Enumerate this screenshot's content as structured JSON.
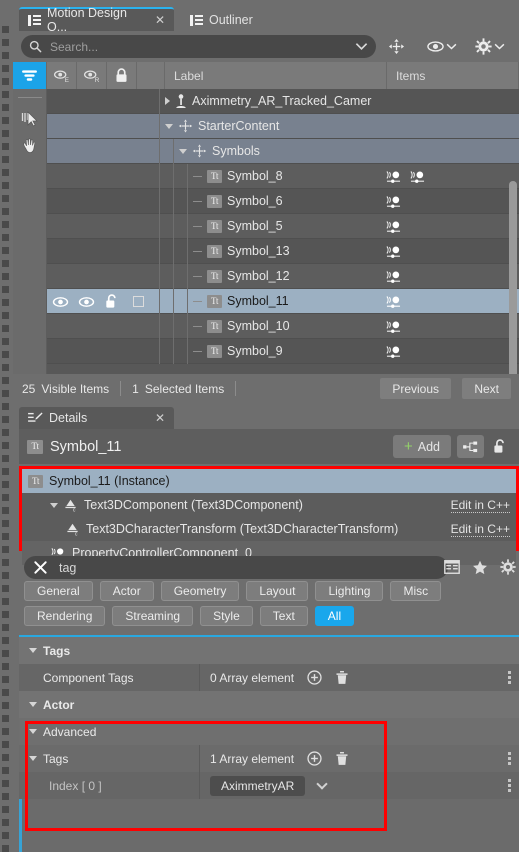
{
  "outliner": {
    "tabs": [
      {
        "label": "Motion Design O...",
        "icon": "list-icon",
        "active": true,
        "close": "✕"
      },
      {
        "label": "Outliner",
        "icon": "list-icon",
        "active": false
      }
    ],
    "search": {
      "placeholder": "Search...",
      "value": ""
    },
    "columns": {
      "label": "Label",
      "items": "Items"
    },
    "column_icons": {
      "filter": "filter-icon",
      "eye_e": "eye-e-icon",
      "eye_r": "eye-r-icon",
      "lock": "lock-icon"
    },
    "header_icons": [
      "move-icon",
      "eye-dropdown-icon",
      "settings-dropdown-icon"
    ],
    "toolbar_icons": [
      "select-cursor-icon",
      "hand-icon"
    ],
    "rows": [
      {
        "name": "Aximmetry_AR_Tracked_Camer",
        "depth": 3,
        "expander": "right",
        "icon": "actor-icon",
        "state": "dark",
        "items": 0
      },
      {
        "name": "StarterContent",
        "depth": 3,
        "expander": "down",
        "icon": "folder-move-icon",
        "state": "hl",
        "items": 0
      },
      {
        "name": "Symbols",
        "depth": 4,
        "expander": "down",
        "icon": "folder-move-icon",
        "state": "hl",
        "items": 0
      },
      {
        "name": "Symbol_8",
        "depth": 5,
        "expander": "none",
        "icon": "text3d-icon",
        "state": "alt",
        "items": 2
      },
      {
        "name": "Symbol_6",
        "depth": 5,
        "expander": "none",
        "icon": "text3d-icon",
        "state": "dark",
        "items": 1
      },
      {
        "name": "Symbol_5",
        "depth": 5,
        "expander": "none",
        "icon": "text3d-icon",
        "state": "alt",
        "items": 1
      },
      {
        "name": "Symbol_13",
        "depth": 5,
        "expander": "none",
        "icon": "text3d-icon",
        "state": "dark",
        "items": 1
      },
      {
        "name": "Symbol_12",
        "depth": 5,
        "expander": "none",
        "icon": "text3d-icon",
        "state": "alt",
        "items": 1
      },
      {
        "name": "Symbol_11",
        "depth": 5,
        "expander": "none",
        "icon": "text3d-icon",
        "state": "sel",
        "items": 1
      },
      {
        "name": "Symbol_10",
        "depth": 5,
        "expander": "none",
        "icon": "text3d-icon",
        "state": "alt",
        "items": 1
      },
      {
        "name": "Symbol_9",
        "depth": 5,
        "expander": "none",
        "icon": "text3d-icon",
        "state": "dark",
        "items": 1
      }
    ],
    "status": {
      "visible_count": "25",
      "visible_label": "Visible Items",
      "selected_count": "1",
      "selected_label": "Selected Items",
      "previous": "Previous",
      "next": "Next"
    }
  },
  "details": {
    "tab": {
      "label": "Details",
      "icon": "details-pencil-icon",
      "close": "✕"
    },
    "header": {
      "title": "Symbol_11",
      "icon": "text3d-icon",
      "add_label": "Add",
      "add_icon": "plus-icon",
      "graph_icon": "blueprint-icon",
      "lock_icon": "unlock-icon"
    },
    "components": [
      {
        "label": "Symbol_11 (Instance)",
        "icon": "text3d-icon",
        "depth": 0,
        "expander": "none",
        "selected": true,
        "action": ""
      },
      {
        "label": "Text3DComponent (Text3DComponent)",
        "icon": "text3d-comp-icon",
        "depth": 1,
        "expander": "down",
        "selected": false,
        "action": "Edit in C++"
      },
      {
        "label": "Text3DCharacterTransform (Text3DCharacterTransform)",
        "icon": "text3d-comp-icon",
        "depth": 2,
        "expander": "none",
        "selected": false,
        "action": "Edit in C++"
      },
      {
        "label": "PropertyControllerComponent_0",
        "icon": "property-controller-icon",
        "depth": 1,
        "expander": "none",
        "selected": false,
        "action": ""
      }
    ],
    "property_search": {
      "value": "tag",
      "clear_icon": "clear-x-icon",
      "icons": [
        "table-view-icon",
        "favorite-star-icon",
        "settings-gear-icon"
      ]
    },
    "filter_chips_row1": [
      "General",
      "Actor",
      "Geometry",
      "Layout",
      "Lighting",
      "Misc"
    ],
    "filter_chips_row2": [
      "Rendering",
      "Streaming",
      "Style",
      "Text",
      "All"
    ],
    "active_chip": "All",
    "properties": [
      {
        "kind": "category",
        "name": "Tags",
        "value": "",
        "expander": "down",
        "highlight": false
      },
      {
        "kind": "row",
        "name": "Component Tags",
        "value": "0 Array element",
        "expander": "none",
        "add_icon": "add-circle-icon",
        "delete_icon": "trash-icon",
        "menu": true,
        "highlight": false
      },
      {
        "kind": "category",
        "name": "Actor",
        "value": "",
        "expander": "down",
        "highlight": true
      },
      {
        "kind": "subcategory",
        "name": "Advanced",
        "value": "",
        "expander": "down",
        "highlight": true
      },
      {
        "kind": "category2",
        "name": "Tags",
        "value": "1 Array element",
        "expander": "down",
        "add_icon": "add-circle-icon",
        "delete_icon": "trash-icon",
        "menu": true,
        "highlight": true
      },
      {
        "kind": "indexrow",
        "name": "Index [ 0 ]",
        "value": "AximmetryAR",
        "expander": "none",
        "dropdown_icon": "chevron-down-icon",
        "menu": true,
        "highlight": true
      }
    ]
  },
  "colors": {
    "accent_blue": "#19a7ec",
    "selection": "#9cb0c2",
    "hover": "#78818f",
    "panel_bg": "#6e6e6e",
    "annotation_red": "#ff0000"
  }
}
